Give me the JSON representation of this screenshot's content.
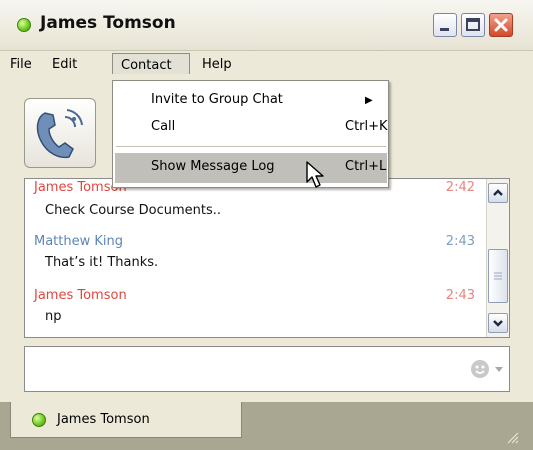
{
  "window": {
    "title": "James Tomson",
    "status": "online",
    "accent_online": "#6dc71f"
  },
  "menubar": {
    "items": [
      "File",
      "Edit",
      "Contact",
      "Help"
    ],
    "active": "Contact"
  },
  "contact_menu": {
    "items": [
      {
        "label": "Invite to Group Chat",
        "shortcut": "",
        "submenu": true
      },
      {
        "label": "Call",
        "shortcut": "Ctrl+K",
        "submenu": false
      },
      {
        "label": "Show Message Log",
        "shortcut": "Ctrl+L",
        "submenu": false,
        "highlighted": true
      }
    ]
  },
  "toolbar": {
    "call_icon": "phone-icon"
  },
  "chat_log": {
    "messages": [
      {
        "sender": "James Tomson",
        "time": "2:42",
        "text": "Check Course Documents..",
        "color": "#e0463e"
      },
      {
        "sender": "Matthew King",
        "time": "2:43",
        "text": "That’s it! Thanks.",
        "color": "#5d86b5"
      },
      {
        "sender": "James Tomson",
        "time": "2:43",
        "text": "np",
        "color": "#e0463e"
      }
    ]
  },
  "input": {
    "value": "",
    "emoticon_icon": "smiley-icon"
  },
  "tabs": [
    {
      "label": "James Tomson",
      "status": "online"
    }
  ]
}
